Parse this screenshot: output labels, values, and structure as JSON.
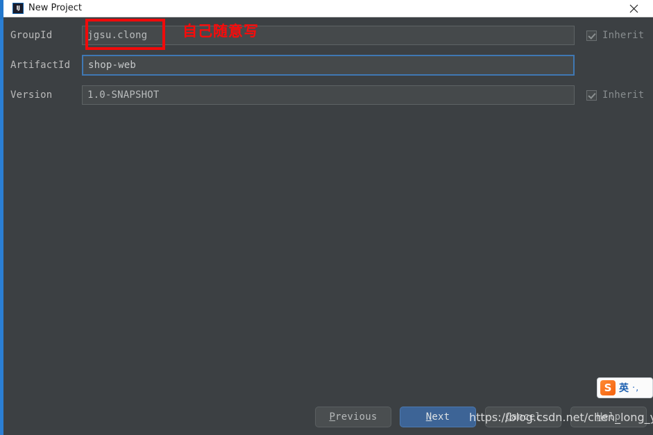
{
  "window": {
    "title": "New Project",
    "app_icon": "intellij-idea-icon",
    "close_icon": "close-icon",
    "background_color": "#3c4043",
    "titlebar_color": "#ffffff"
  },
  "form": {
    "rows": [
      {
        "label": "GroupId",
        "value": "jgsu.clong",
        "placeholder": "",
        "focused": false,
        "inherit_label": "Inherit",
        "inherit_checked": true,
        "has_inherit": true
      },
      {
        "label": "ArtifactId",
        "value": "shop-web",
        "placeholder": "",
        "focused": true,
        "inherit_label": "",
        "inherit_checked": false,
        "has_inherit": false
      },
      {
        "label": "Version",
        "value": "1.0-SNAPSHOT",
        "placeholder": "",
        "focused": false,
        "inherit_label": "Inherit",
        "inherit_checked": true,
        "has_inherit": true
      }
    ]
  },
  "annotation": {
    "text": "自己随意写",
    "color": "#fb0a0a",
    "box_target": "GroupId"
  },
  "buttons": {
    "previous": {
      "prefix": "",
      "mnemonic": "P",
      "suffix": "revious"
    },
    "next": {
      "prefix": "",
      "mnemonic": "N",
      "suffix": "ext"
    },
    "cancel": {
      "prefix": "",
      "mnemonic": "C",
      "suffix": "ancel"
    },
    "help": {
      "prefix": "",
      "mnemonic": "H",
      "suffix": "elp"
    },
    "accent_color": "#3d6496"
  },
  "watermark": {
    "text": "https://blog.csdn.net/chen_long_yue"
  },
  "ime": {
    "logo_text": "S",
    "mode": "英",
    "dots": "·,"
  }
}
